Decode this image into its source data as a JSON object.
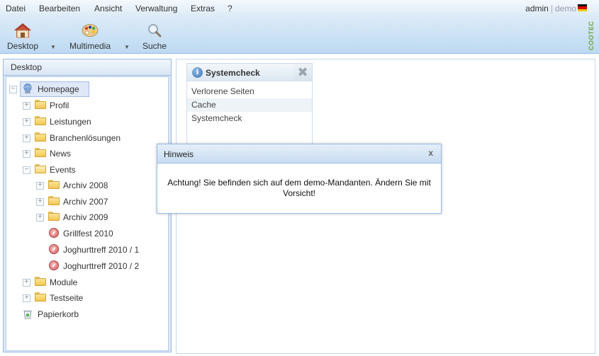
{
  "menu": {
    "items": [
      "Datei",
      "Bearbeiten",
      "Ansicht",
      "Verwaltung",
      "Extras",
      "?"
    ],
    "user": "admin",
    "tenant": "demo"
  },
  "toolbar": {
    "desktop_label": "Desktop",
    "multimedia_label": "Multimedia",
    "search_label": "Suche",
    "brand": "COOTEC"
  },
  "left_panel": {
    "title": "Desktop",
    "tree": [
      {
        "label": "Homepage",
        "type": "root"
      },
      {
        "label": "Profil",
        "type": "folder"
      },
      {
        "label": "Leistungen",
        "type": "folder"
      },
      {
        "label": "Branchenlösungen",
        "type": "folder"
      },
      {
        "label": "News",
        "type": "folder"
      },
      {
        "label": "Events",
        "type": "folder-open"
      },
      {
        "label": "Archiv 2008",
        "type": "folder"
      },
      {
        "label": "Archiv 2007",
        "type": "folder"
      },
      {
        "label": "Archiv 2009",
        "type": "folder"
      },
      {
        "label": "Grillfest 2010",
        "type": "event"
      },
      {
        "label": "Joghurttreff 2010 / 1",
        "type": "event"
      },
      {
        "label": "Joghurttreff 2010 / 2",
        "type": "event"
      },
      {
        "label": "Module",
        "type": "folder"
      },
      {
        "label": "Testseite",
        "type": "folder"
      },
      {
        "label": "Papierkorb",
        "type": "trash"
      }
    ]
  },
  "portlet": {
    "title": "Systemcheck",
    "items": [
      "Verlorene Seiten",
      "Cache",
      "Systemcheck"
    ]
  },
  "dialog": {
    "title": "Hinweis",
    "close": "x",
    "message": "Achtung! Sie befinden sich auf dem demo-Mandanten. Ändern Sie mit Vorsicht!"
  }
}
